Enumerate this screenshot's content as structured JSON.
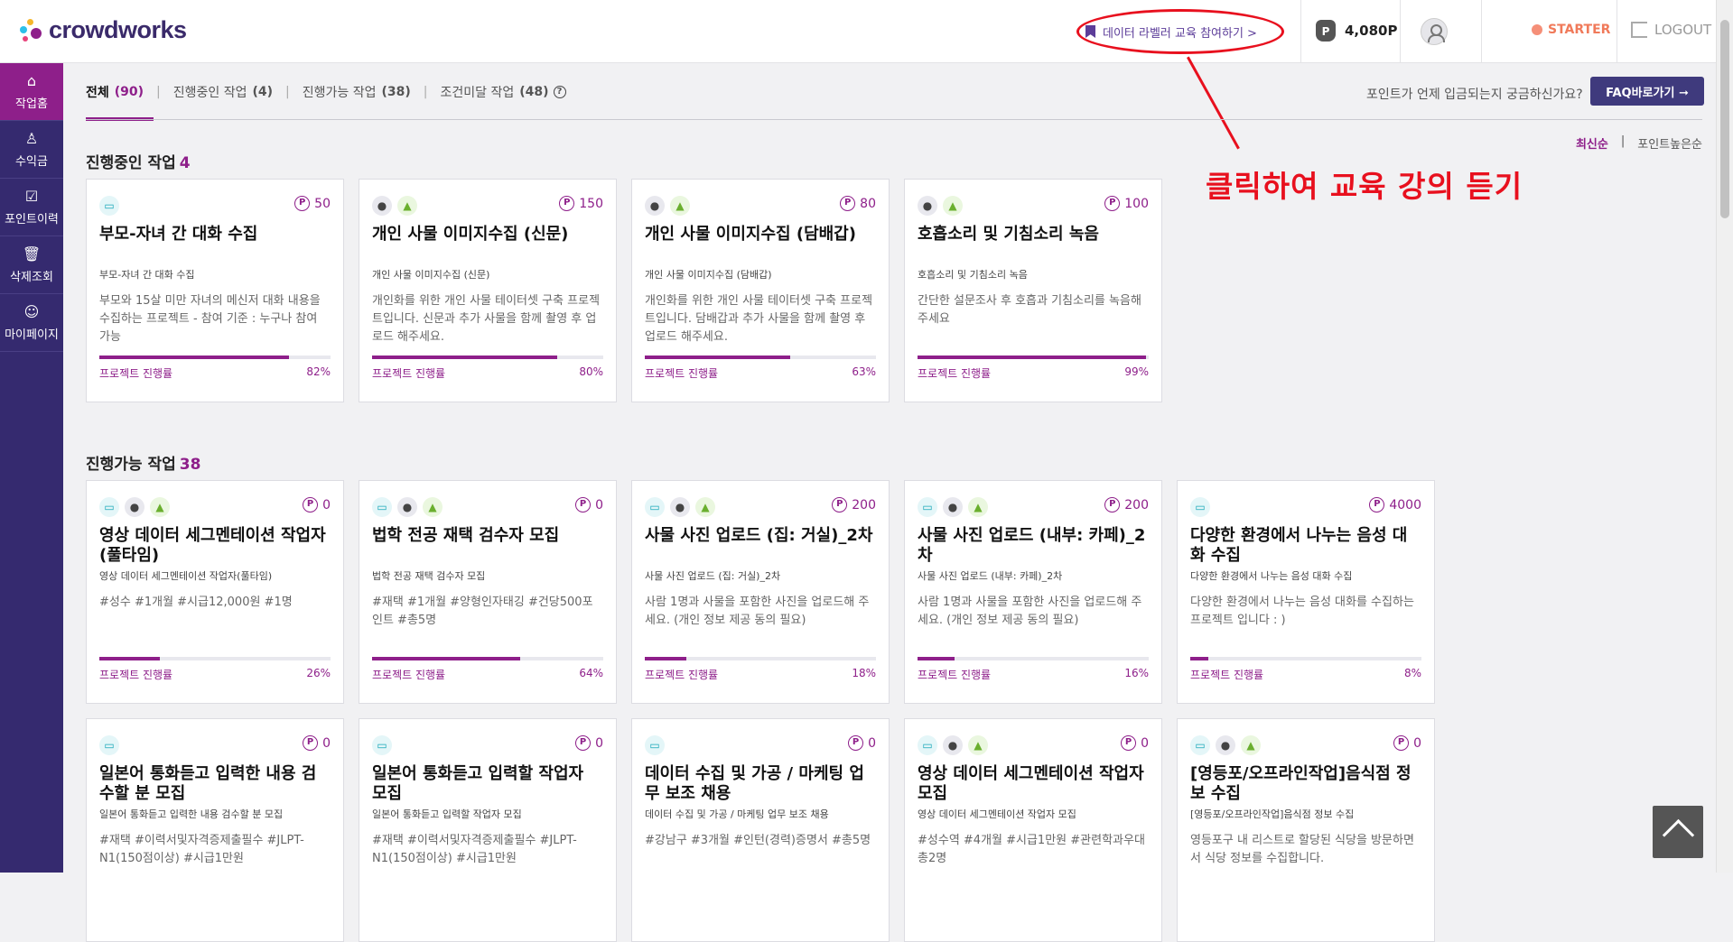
{
  "header": {
    "logo_text": "crowdworks",
    "edu_button": "데이터 라벨러 교육 참여하기  >",
    "points": "4,080P",
    "grade": "STARTER",
    "logout": "LOGOUT"
  },
  "annotation": "클릭하여 교육 강의 듣기",
  "sidebar": [
    {
      "label": "작업홈",
      "icon": "home-icon"
    },
    {
      "label": "수익금",
      "icon": "money-bag-icon"
    },
    {
      "label": "포인트이력",
      "icon": "history-icon"
    },
    {
      "label": "삭제조회",
      "icon": "trash-icon"
    },
    {
      "label": "마이페이지",
      "icon": "user-icon"
    }
  ],
  "tabs": [
    {
      "label": "전체",
      "count": "(90)"
    },
    {
      "label": "진행중인 작업",
      "count": "(4)"
    },
    {
      "label": "진행가능 작업",
      "count": "(38)"
    },
    {
      "label": "조건미달 작업",
      "count": "(48)"
    }
  ],
  "faq_question": "포인트가 언제 입금되는지 궁금하신가요?",
  "faq_button": "FAQ바로가기 ➞",
  "sort": {
    "latest": "최신순",
    "sep": "|",
    "points": "포인트높은순"
  },
  "sections": {
    "in_progress": {
      "title": "진행중인 작업",
      "count": "4"
    },
    "available": {
      "title": "진행가능 작업",
      "count": "38"
    }
  },
  "progress_label": "프로젝트 진행률",
  "in_progress_cards": [
    {
      "platforms": [
        "pc"
      ],
      "points": "50",
      "title": "부모-자녀 간 대화 수집",
      "subtitle": "부모-자녀 간 대화 수집",
      "desc": "부모와 15살 미만 자녀의 메신저 대화 내용을 수집하는 프로젝트 - 참여 기준 : 누구나 참여 가능",
      "progress": 82,
      "progress_text": "82%"
    },
    {
      "platforms": [
        "ios",
        "android"
      ],
      "points": "150",
      "title": "개인 사물 이미지수집 (신문)",
      "subtitle": "개인 사물 이미지수집 (신문)",
      "desc": "개인화를 위한 개인 사물 테이터셋 구축 프로젝트입니다. 신문과 추가 사물을 함께 촬영 후 업로드 해주세요.",
      "progress": 80,
      "progress_text": "80%"
    },
    {
      "platforms": [
        "ios",
        "android"
      ],
      "points": "80",
      "title": "개인 사물 이미지수집 (담배갑)",
      "subtitle": "개인 사물 이미지수집 (담배갑)",
      "desc": "개인화를 위한 개인 사물 테이터셋 구축 프로젝트입니다. 담배갑과 추가 사물을 함께 촬영 후 업로드 해주세요.",
      "progress": 63,
      "progress_text": "63%"
    },
    {
      "platforms": [
        "ios",
        "android"
      ],
      "points": "100",
      "title": "호흡소리 및 기침소리 녹음",
      "subtitle": "호흡소리 및 기침소리 녹음",
      "desc": "간단한 설문조사 후 호흡과 기침소리를 녹음해 주세요",
      "progress": 99,
      "progress_text": "99%"
    }
  ],
  "available_cards": [
    {
      "platforms": [
        "pc",
        "ios",
        "android"
      ],
      "points": "0",
      "title": "영상 데이터 세그멘테이션 작업자(풀타임)",
      "subtitle": "영상 데이터 세그멘테이션 작업자(풀타임)",
      "desc": "#성수 #1개월 #시급12,000원 #1명",
      "progress": 26,
      "progress_text": "26%"
    },
    {
      "platforms": [
        "pc",
        "ios",
        "android"
      ],
      "points": "0",
      "title": "법학 전공 재택 검수자 모집",
      "subtitle": "법학 전공 재택 검수자 모집",
      "desc": "#재택 #1개월 #양형인자태깅 #건당500포인트 #총5명",
      "progress": 64,
      "progress_text": "64%"
    },
    {
      "platforms": [
        "pc",
        "ios",
        "android"
      ],
      "points": "200",
      "title": "사물 사진 업로드 (집: 거실)_2차",
      "subtitle": "사물 사진 업로드 (집: 거실)_2차",
      "desc": "사람 1명과 사물을 포함한 사진을 업로드해 주세요. (개인 정보 제공 동의 필요)",
      "progress": 18,
      "progress_text": "18%"
    },
    {
      "platforms": [
        "pc",
        "ios",
        "android"
      ],
      "points": "200",
      "title": "사물 사진 업로드 (내부: 카페)_2차",
      "subtitle": "사물 사진 업로드 (내부: 카페)_2차",
      "desc": "사람 1명과 사물을 포함한 사진을 업로드해 주세요. (개인 정보 제공 동의 필요)",
      "progress": 16,
      "progress_text": "16%"
    },
    {
      "platforms": [
        "pc"
      ],
      "points": "4000",
      "title": "다양한 환경에서 나누는 음성 대화 수집",
      "subtitle": "다양한 환경에서 나누는 음성 대화 수집",
      "desc": "다양한 환경에서 나누는 음성 대화를 수집하는 프로젝트 입니다 : )",
      "progress": 8,
      "progress_text": "8%"
    }
  ],
  "more_cards": [
    {
      "platforms": [
        "pc"
      ],
      "points": "0",
      "title": "일본어 통화듣고 입력한 내용 검수할 분 모집",
      "subtitle": "일본어 통화듣고 입력한 내용 검수할 분 모집",
      "desc": "#재택 #이력서및자격증제출필수 #JLPT-N1(150점이상) #시급1만원"
    },
    {
      "platforms": [
        "pc"
      ],
      "points": "0",
      "title": "일본어 통화듣고 입력할 작업자 모집",
      "subtitle": "일본어 통화듣고 입력할 작업자 모집",
      "desc": "#재택 #이력서및자격증제출필수 #JLPT-N1(150점이상) #시급1만원"
    },
    {
      "platforms": [
        "pc"
      ],
      "points": "0",
      "title": "데이터 수집 및 가공 / 마케팅 업무 보조 채용",
      "subtitle": "데이터 수집 및 가공 / 마케팅 업무 보조 채용",
      "desc": "#강남구 #3개월 #인턴(경력)증명서 #총5명"
    },
    {
      "platforms": [
        "pc",
        "ios",
        "android"
      ],
      "points": "0",
      "title": "영상 데이터 세그멘테이션 작업자 모집",
      "subtitle": "영상 데이터 세그멘테이션 작업자 모집",
      "desc": "#성수역 #4개월 #시급1만원 #관련학과우대 총2명"
    },
    {
      "platforms": [
        "pc",
        "ios",
        "android"
      ],
      "points": "0",
      "title": "[영등포/오프라인작업]음식점 정보 수집",
      "subtitle": "[영등포/오프라인작업]음식점 정보 수집",
      "desc": "영등포구 내 리스트로 할당된 식당을 방문하면서 식당 정보를 수집합니다."
    }
  ],
  "colors": {
    "brand_purple": "#8e1f8a",
    "sidebar": "#352a6f",
    "annotation_red": "#e8101e"
  }
}
